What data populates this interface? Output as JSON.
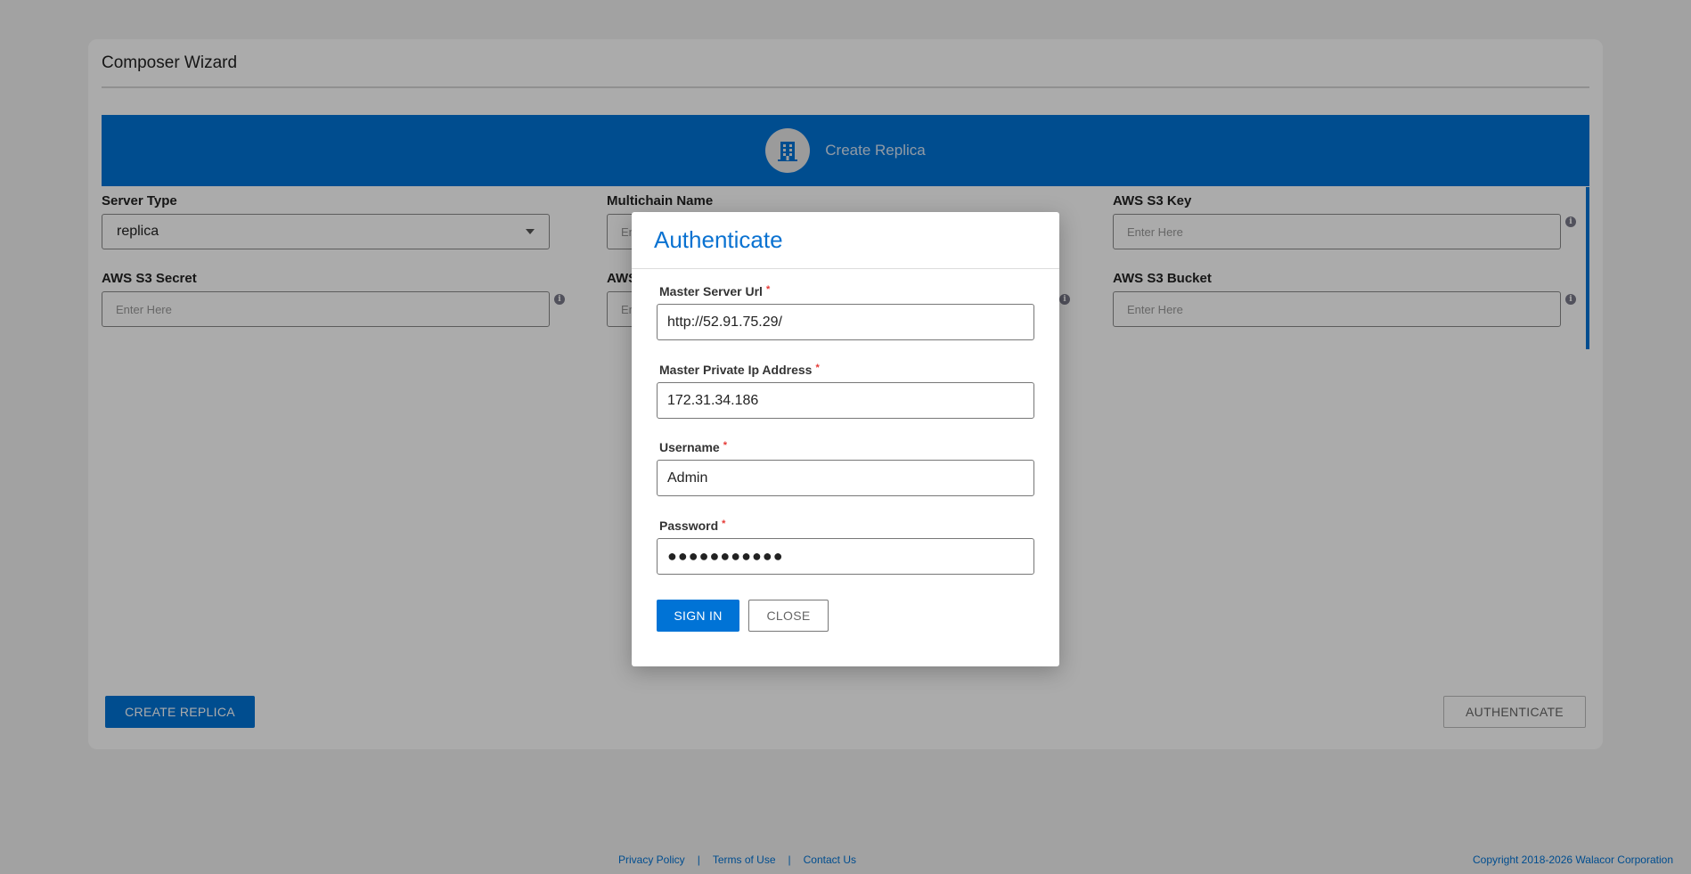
{
  "wizard": {
    "title": "Composer Wizard",
    "step_label": "Create Replica",
    "step_icon": "building-icon",
    "accent_color": "#0073d6"
  },
  "form": {
    "server_type": {
      "label": "Server Type",
      "value": "replica"
    },
    "multichain_name": {
      "label": "Multichain Name",
      "placeholder": "Enter Here"
    },
    "aws_s3_key": {
      "label": "AWS S3 Key",
      "placeholder": "Enter Here"
    },
    "aws_s3_secret": {
      "label": "AWS S3 Secret",
      "placeholder": "Enter Here"
    },
    "aws_s3_region": {
      "label": "AWS",
      "placeholder": "Enter Here"
    },
    "aws_s3_bucket": {
      "label": "AWS S3 Bucket",
      "placeholder": "Enter Here"
    }
  },
  "actions": {
    "create_replica": "CREATE REPLICA",
    "authenticate": "AUTHENTICATE"
  },
  "footer": {
    "privacy": "Privacy Policy",
    "separator": "|",
    "terms": "Terms of Use",
    "contact": "Contact Us",
    "copyright": "Copyright 2018-2026 Walacor Corporation"
  },
  "modal": {
    "title": "Authenticate",
    "required_mark": "*",
    "master_server_url": {
      "label": "Master Server Url",
      "value": "http://52.91.75.29/"
    },
    "master_private_ip": {
      "label": "Master Private Ip Address",
      "value": "172.31.34.186"
    },
    "username": {
      "label": "Username",
      "value": "Admin"
    },
    "password": {
      "label": "Password",
      "value": "●●●●●●●●●●●"
    },
    "sign_in": "SIGN IN",
    "close": "CLOSE"
  }
}
